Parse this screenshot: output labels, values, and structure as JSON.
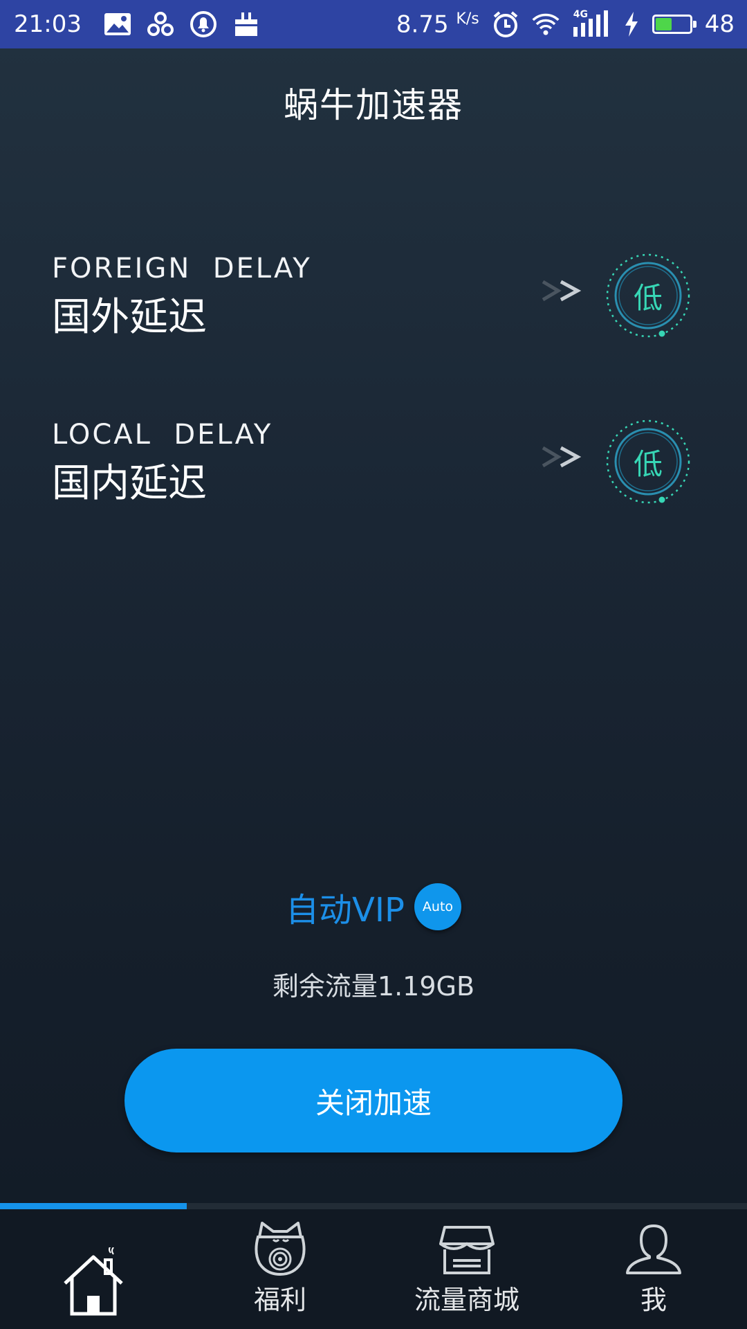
{
  "status_bar": {
    "time": "21:03",
    "net_speed": "8.75",
    "net_speed_unit": "K/s",
    "network_type": "4G",
    "battery_level": "48",
    "battery_fraction": 0.48,
    "color": "#2e44a3",
    "icons": [
      "image-icon",
      "fan-icon",
      "alarm-bell-icon",
      "bag-icon",
      "alarm-clock-icon",
      "wifi-icon",
      "signal-icon",
      "charging-icon",
      "battery-icon"
    ]
  },
  "header": {
    "title": "蜗牛加速器"
  },
  "delays": [
    {
      "label_en": "FOREIGN  DELAY",
      "label_cn": "国外延迟",
      "level": "低"
    },
    {
      "label_en": "LOCAL  DELAY",
      "label_cn": "国内延迟",
      "level": "低"
    }
  ],
  "vip": {
    "label": "自动VIP",
    "badge": "Auto",
    "color": "#1c8fe8"
  },
  "remaining": {
    "text": "剩余流量1.19GB"
  },
  "main_button": {
    "label": "关闭加速",
    "color": "#0b97ef"
  },
  "gauge_color": "#37d6b5",
  "tabs": [
    {
      "label": "",
      "icon": "home-icon",
      "active": true
    },
    {
      "label": "福利",
      "icon": "lucky-cat-icon",
      "active": false
    },
    {
      "label": "流量商城",
      "icon": "store-icon",
      "active": false
    },
    {
      "label": "我",
      "icon": "user-icon",
      "active": false
    }
  ]
}
